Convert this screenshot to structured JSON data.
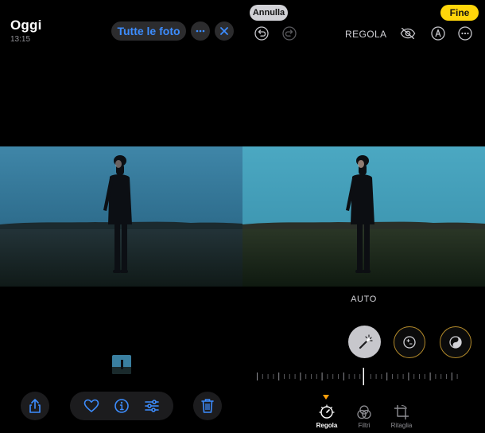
{
  "left": {
    "header": {
      "title": "Oggi",
      "time": "13:15"
    },
    "all_photos_label": "Tutte le foto",
    "icons": {
      "more": "ellipsis-icon",
      "close": "close-icon",
      "share": "share-icon",
      "favorite": "heart-icon",
      "info": "info-icon",
      "edit": "sliders-icon",
      "delete": "trash-icon"
    }
  },
  "right": {
    "cancel_label": "Annulla",
    "done_label": "Fine",
    "mode_title": "REGOLA",
    "adjust_label": "AUTO",
    "tabs": [
      {
        "label": "Regola",
        "icon": "dial-knob-icon",
        "selected": true
      },
      {
        "label": "Filtri",
        "icon": "filters-icon",
        "selected": false
      },
      {
        "label": "Ritaglia",
        "icon": "crop-rotate-icon",
        "selected": false
      }
    ],
    "adjustments": [
      {
        "icon": "magic-wand-icon",
        "selected": true
      },
      {
        "icon": "exposure-icon",
        "selected": false
      },
      {
        "icon": "brilliance-icon",
        "selected": false
      }
    ]
  },
  "colors": {
    "accent_blue": "#3d8dff",
    "accent_yellow": "#ffd60a",
    "indicator_orange": "#ff9f0a",
    "dial_ring_gold": "#b38a2a"
  }
}
